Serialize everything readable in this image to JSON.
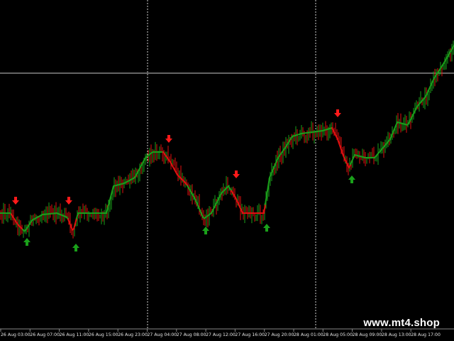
{
  "chart_data": {
    "type": "candlestick",
    "x_tick_labels": [
      "26 Aug 03:00",
      "26 Aug 07:00",
      "26 Aug 11:00",
      "26 Aug 15:00",
      "26 Aug 23:00",
      "27 Aug 04:00",
      "27 Aug 08:00",
      "27 Aug 12:00",
      "27 Aug 16:00",
      "27 Aug 20:00",
      "28 Aug 01:00",
      "28 Aug 05:00",
      "28 Aug 09:00",
      "28 Aug 13:00",
      "28 Aug 17:00"
    ],
    "grid": false,
    "session_separators": [
      "26 Aug 23:00",
      "28 Aug 01:00"
    ],
    "horizontal_line": true,
    "trend_line_colors": {
      "up": "#1a9e1a",
      "down": "#e01010"
    },
    "candle_colors": {
      "bull": "#1aa01a",
      "bear": "#e01010"
    },
    "signals": [
      {
        "type": "sell",
        "label_index": 0
      },
      {
        "type": "buy",
        "label_index": 1
      },
      {
        "type": "sell",
        "label_index": 2
      },
      {
        "type": "buy",
        "label_index": 2
      },
      {
        "type": "sell",
        "label_index": 5
      },
      {
        "type": "buy",
        "label_index": 6
      },
      {
        "type": "sell",
        "label_index": 7
      },
      {
        "type": "buy",
        "label_index": 8
      },
      {
        "type": "sell",
        "label_index": 10
      },
      {
        "type": "buy",
        "label_index": 11
      }
    ],
    "signal_colors": {
      "sell": "#ff1a1a",
      "buy": "#1aa01a"
    }
  },
  "watermark": "www.mt4.shop"
}
